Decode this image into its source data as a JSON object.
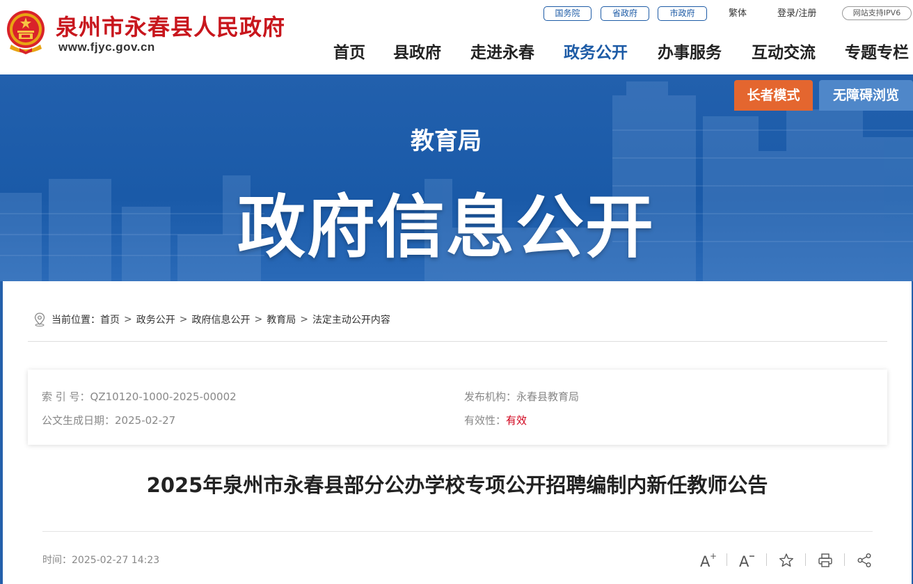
{
  "header": {
    "site_name": "泉州市永春县人民政府",
    "site_url": "www.fjyc.gov.cn",
    "top_links": [
      "国务院",
      "省政府",
      "市政府"
    ],
    "traditional": "繁体",
    "login": "登录/注册",
    "ipv6": "网站支持IPV6",
    "nav": [
      "首页",
      "县政府",
      "走进永春",
      "政务公开",
      "办事服务",
      "互动交流",
      "专题专栏"
    ],
    "active_nav": "政务公开",
    "brand_color": "#c8161d",
    "accent_color": "#1d5ba6"
  },
  "banner": {
    "subtitle": "教育局",
    "title": "政府信息公开",
    "elder_mode": "长者模式",
    "accessible": "无障碍浏览",
    "elder_color": "#e4662f",
    "accessible_color": "#4f87c9"
  },
  "breadcrumb": {
    "label": "当前位置：",
    "items": [
      "首页",
      "政务公开",
      "政府信息公开",
      "教育局",
      "法定主动公开内容"
    ],
    "separator": ">"
  },
  "meta": {
    "index_label": "索 引 号：",
    "index_value": "QZ10120-1000-2025-00002",
    "date_label": "公文生成日期：",
    "date_value": "2025-02-27",
    "publisher_label": "发布机构：",
    "publisher_value": "永春县教育局",
    "validity_label": "有效性：",
    "validity_value": "有效"
  },
  "article": {
    "title": "2025年泉州市永春县部分公办学校专项公开招聘编制内新任教师公告",
    "time_label": "时间：",
    "time_value": "2025-02-27 14:23",
    "tools": [
      "font-increase-icon",
      "font-decrease-icon",
      "favorite-star-icon",
      "print-icon",
      "share-icon"
    ]
  }
}
